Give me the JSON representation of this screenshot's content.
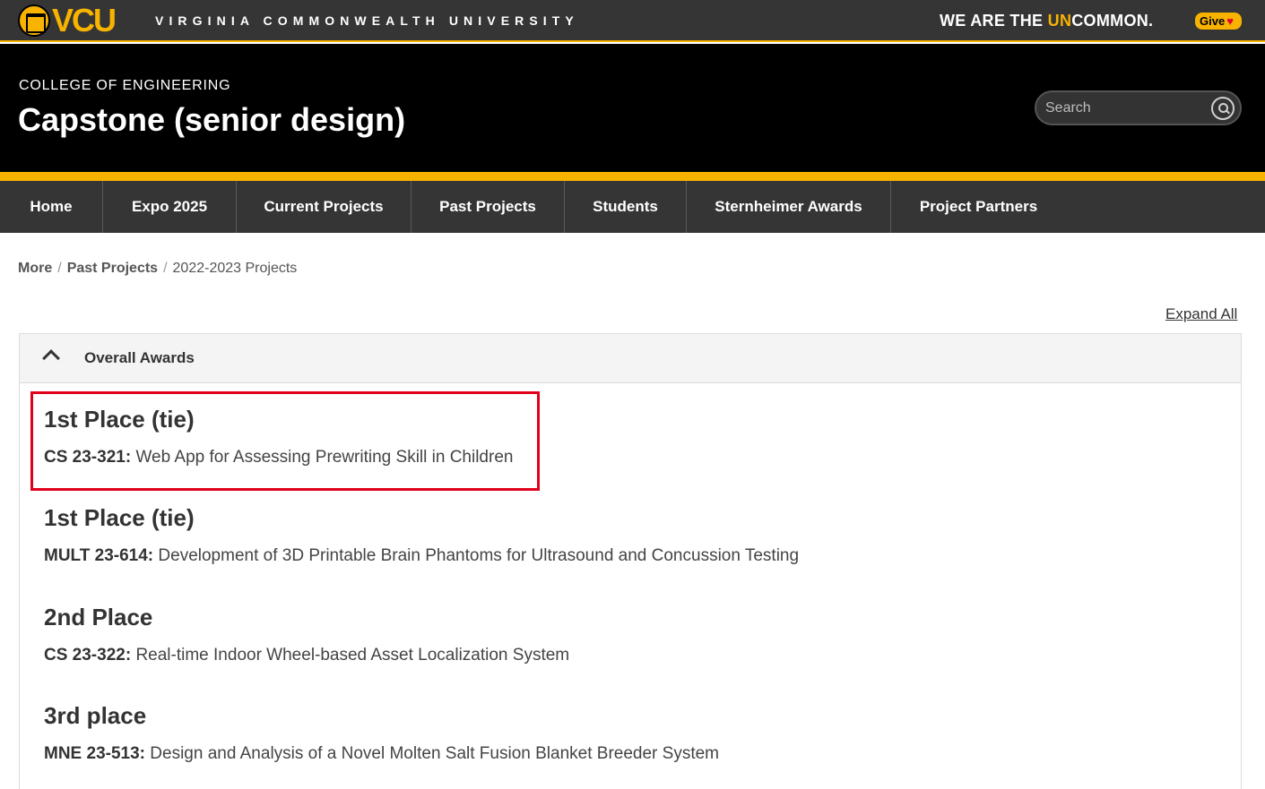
{
  "brand": {
    "logo_text": "VCU",
    "university": "VIRGINIA COMMONWEALTH UNIVERSITY",
    "tagline_pre": "WE ARE THE ",
    "tagline_hl": "UN",
    "tagline_post": "COMMON.",
    "give_label": "Give",
    "give_heart": "♥",
    "accent_color": "#f8b300"
  },
  "header": {
    "college": "COLLEGE OF ENGINEERING",
    "title": "Capstone (senior design)",
    "search_placeholder": "Search"
  },
  "nav": {
    "items": [
      {
        "label": "Home"
      },
      {
        "label": "Expo 2025"
      },
      {
        "label": "Current Projects"
      },
      {
        "label": "Past Projects"
      },
      {
        "label": "Students"
      },
      {
        "label": "Sternheimer Awards"
      },
      {
        "label": "Project Partners"
      }
    ]
  },
  "breadcrumb": {
    "items": [
      "More",
      "Past Projects"
    ],
    "separator": "/",
    "current": "2022-2023 Projects"
  },
  "expand_all": "Expand All",
  "accordion": {
    "title": "Overall Awards",
    "awards": [
      {
        "place": "1st Place (tie)",
        "code": "CS 23-321:",
        "project": " Web App for Assessing Prewriting Skill in Children"
      },
      {
        "place": "1st Place (tie)",
        "code": "MULT 23-614:",
        "project": " Development of 3D Printable Brain Phantoms for Ultrasound and Concussion Testing"
      },
      {
        "place": "2nd Place",
        "code": "CS 23-322:",
        "project": " Real-time Indoor Wheel-based Asset Localization System"
      },
      {
        "place": "3rd place",
        "code": "MNE 23-513:",
        "project": " Design and Analysis of a Novel Molten Salt Fusion Blanket Breeder System"
      }
    ]
  }
}
